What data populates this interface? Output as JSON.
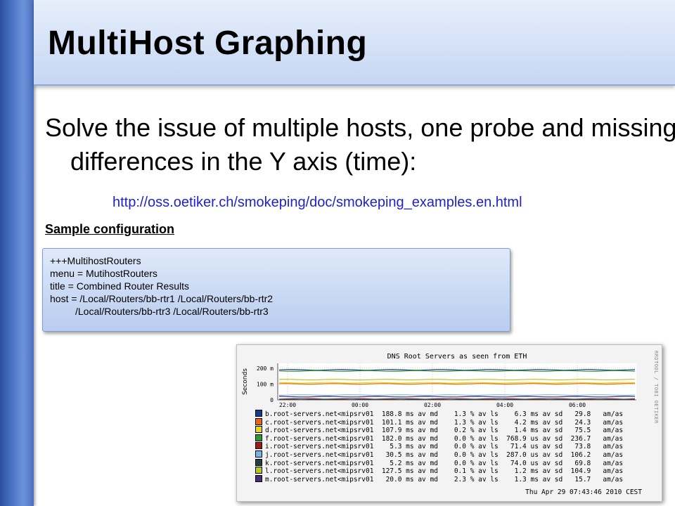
{
  "slide": {
    "title": "MultiHost Graphing",
    "bullet": "Solve the issue of multiple hosts, one probe and missing differences in the Y axis (time):",
    "link": "http://oss.oetiker.ch/smokeping/doc/smokeping_examples.en.html",
    "sample_heading": "Sample configuration",
    "config_lines": [
      "+++MultihostRouters",
      "menu = MutihostRouters",
      "title = Combined Router Results",
      "host = /Local/Routers/bb-rtr1 /Local/Routers/bb-rtr2",
      "/Local/Routers/bb-rtr3 /Local/Routers/bb-rtr3"
    ]
  },
  "graph": {
    "title": "DNS Root Servers as seen from ETH",
    "ylabel": "Seconds",
    "credit": "RRDTOOL / TOBI OETIKER",
    "date": "Thu Apr 29 07:43:46 2010 CEST",
    "legend": [
      {
        "color": "#1a3a8c",
        "text": "b.root-servers.net<mipsrv01  188.8 ms av md    1.3 % av ls    6.3 ms av sd   29.8   am/as"
      },
      {
        "color": "#e8641c",
        "text": "c.root-servers.net<mipsrv01  101.1 ms av md    1.3 % av ls    4.2 ms av sd   24.3   am/as"
      },
      {
        "color": "#e8d418",
        "text": "d.root-servers.net<mipsrv01  107.9 ms av md    0.2 % av ls    1.4 ms av sd   75.5   am/as"
      },
      {
        "color": "#2a9a2a",
        "text": "f.root-servers.net<mipsrv01  182.0 ms av md    0.0 % av ls  768.9 us av sd  236.7   am/as"
      },
      {
        "color": "#a01818",
        "text": "i.root-servers.net<mipsrv01    5.3 ms av md    0.0 % av ls   71.4 us av sd   73.8   am/as"
      },
      {
        "color": "#7ab4e6",
        "text": "j.root-servers.net<mipsrv01   30.5 ms av md    0.0 % av ls  287.0 us av sd  106.2   am/as"
      },
      {
        "color": "#1f3f3f",
        "text": "k.root-servers.net<mipsrv01    5.2 ms av md    0.0 % av ls   74.0 us av sd   69.8   am/as"
      },
      {
        "color": "#b8c81a",
        "text": "l.root-servers.net<mipsrv01  127.5 ms av md    0.1 % av ls    1.2 ms av sd  104.9   am/as"
      },
      {
        "color": "#4a2a7a",
        "text": "m.root-servers.net<mipsrv01   20.0 ms av md    2.3 % av ls    1.3 ms av sd   15.7   am/as"
      }
    ]
  },
  "chart_data": {
    "type": "line",
    "title": "DNS Root Servers as seen from ETH",
    "ylabel": "Seconds",
    "y_ticks": [
      "0",
      "100 m",
      "200 m"
    ],
    "x_ticks": [
      "22:00",
      "00:00",
      "02:00",
      "04:00",
      "06:00"
    ],
    "ylim": [
      0,
      0.23
    ],
    "series": [
      {
        "name": "b.root-servers.net<mipsrv01",
        "color": "#1a3a8c",
        "median_s": 0.1888
      },
      {
        "name": "c.root-servers.net<mipsrv01",
        "color": "#e8641c",
        "median_s": 0.1011
      },
      {
        "name": "d.root-servers.net<mipsrv01",
        "color": "#e8d418",
        "median_s": 0.1079
      },
      {
        "name": "f.root-servers.net<mipsrv01",
        "color": "#2a9a2a",
        "median_s": 0.182
      },
      {
        "name": "i.root-servers.net<mipsrv01",
        "color": "#a01818",
        "median_s": 0.0053
      },
      {
        "name": "j.root-servers.net<mipsrv01",
        "color": "#7ab4e6",
        "median_s": 0.0305
      },
      {
        "name": "k.root-servers.net<mipsrv01",
        "color": "#1f3f3f",
        "median_s": 0.0052
      },
      {
        "name": "l.root-servers.net<mipsrv01",
        "color": "#b8c81a",
        "median_s": 0.1275
      },
      {
        "name": "m.root-servers.net<mipsrv01",
        "color": "#4a2a7a",
        "median_s": 0.02
      }
    ]
  }
}
